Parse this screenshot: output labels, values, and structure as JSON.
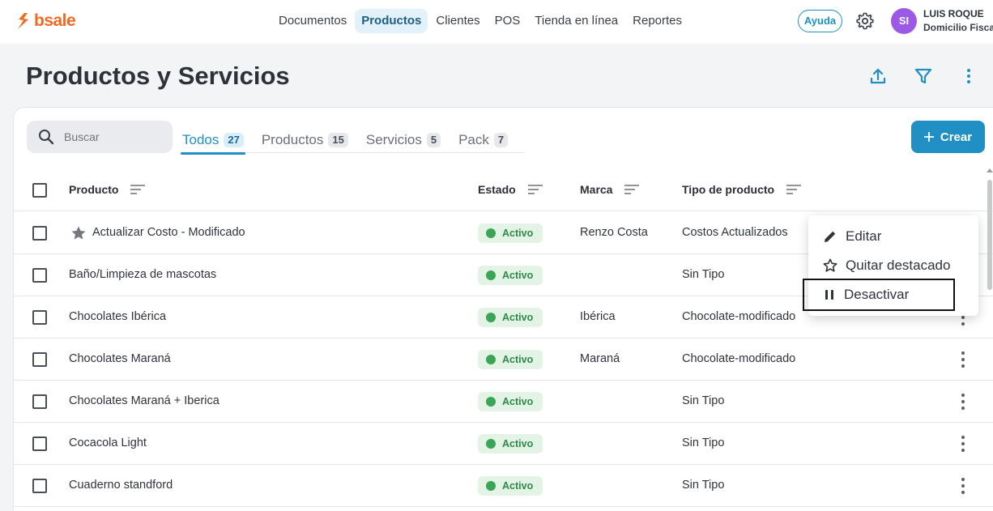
{
  "app": {
    "logo": "bsale",
    "brand_color": "#f26a21",
    "accent_color": "#1f8fc4"
  },
  "nav": [
    {
      "label": "Documentos",
      "active": false
    },
    {
      "label": "Productos",
      "active": true
    },
    {
      "label": "Clientes",
      "active": false
    },
    {
      "label": "POS",
      "active": false
    },
    {
      "label": "Tienda en línea",
      "active": false
    },
    {
      "label": "Reportes",
      "active": false
    }
  ],
  "header": {
    "help": "Ayuda",
    "avatar_initials": "SI",
    "user_name": "LUIS ROQUE",
    "user_office": "Domicilio Fiscal"
  },
  "page": {
    "title": "Productos y Servicios"
  },
  "search": {
    "placeholder": "Buscar"
  },
  "tabs": [
    {
      "label": "Todos",
      "count": "27",
      "active": true
    },
    {
      "label": "Productos",
      "count": "15",
      "active": false
    },
    {
      "label": "Servicios",
      "count": "5",
      "active": false
    },
    {
      "label": "Pack",
      "count": "7",
      "active": false
    }
  ],
  "create_button": "Crear",
  "table": {
    "columns": [
      "Producto",
      "Estado",
      "Marca",
      "Tipo de producto"
    ],
    "rows": [
      {
        "product": "Actualizar Costo - Modificado",
        "featured": true,
        "status": "Activo",
        "brand": "Renzo Costa",
        "type": "Costos Actualizados"
      },
      {
        "product": "Baño/Limpieza de mascotas",
        "featured": false,
        "status": "Activo",
        "brand": "",
        "type": "Sin Tipo"
      },
      {
        "product": "Chocolates Ibérica",
        "featured": false,
        "status": "Activo",
        "brand": "Ibérica",
        "type": "Chocolate-modificado"
      },
      {
        "product": "Chocolates Maraná",
        "featured": false,
        "status": "Activo",
        "brand": "Maraná",
        "type": "Chocolate-modificado"
      },
      {
        "product": "Chocolates Maraná + Iberica",
        "featured": false,
        "status": "Activo",
        "brand": "",
        "type": "Sin Tipo"
      },
      {
        "product": "Cocacola Light",
        "featured": false,
        "status": "Activo",
        "brand": "",
        "type": "Sin Tipo"
      },
      {
        "product": "Cuaderno standford",
        "featured": false,
        "status": "Activo",
        "brand": "",
        "type": "Sin Tipo"
      }
    ]
  },
  "context_menu": {
    "items": [
      {
        "label": "Editar",
        "icon": "pencil-icon"
      },
      {
        "label": "Quitar destacado",
        "icon": "star-outline-icon"
      },
      {
        "label": "Desactivar",
        "icon": "pause-icon"
      }
    ]
  }
}
